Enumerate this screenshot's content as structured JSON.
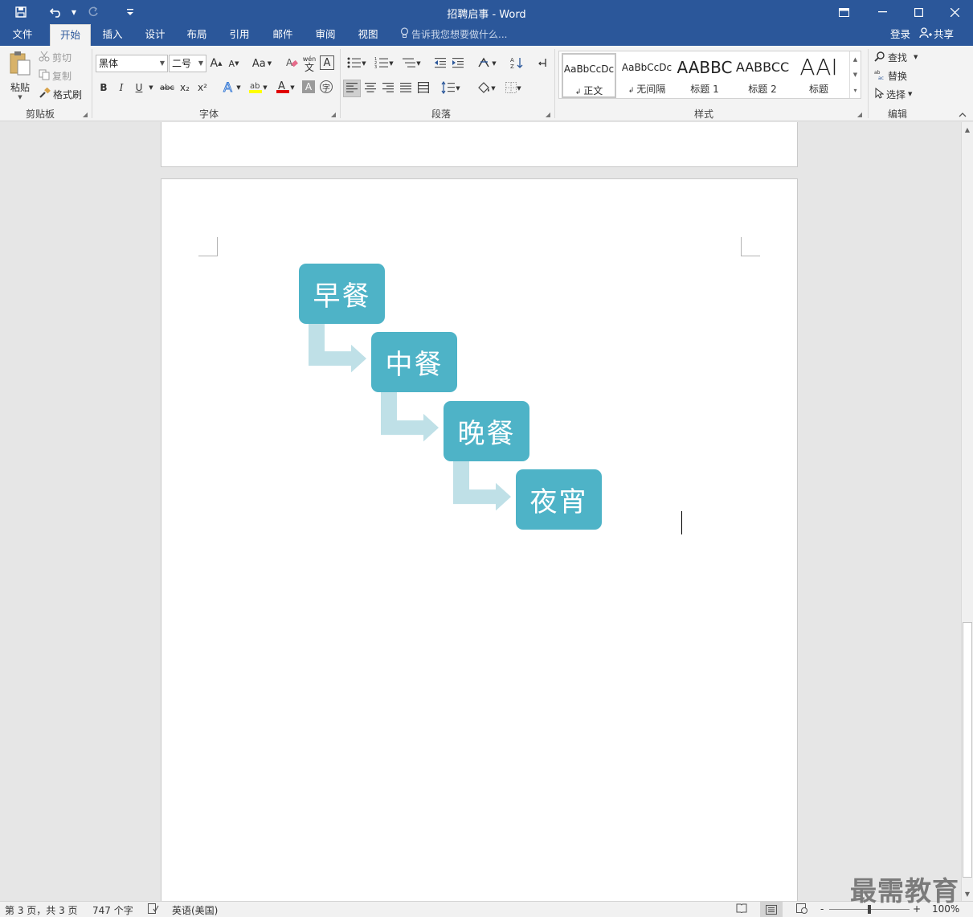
{
  "window": {
    "title": "招聘启事 - Word",
    "qa_save_icon": "save-icon",
    "qa_undo_icon": "undo-icon",
    "qa_redo_icon": "redo-icon",
    "qa_customize_icon": "customize-quick-access-icon"
  },
  "tabs": [
    "文件",
    "开始",
    "插入",
    "设计",
    "布局",
    "引用",
    "邮件",
    "审阅",
    "视图"
  ],
  "active_tab": "开始",
  "tell_me_placeholder": "告诉我您想要做什么...",
  "account": {
    "login": "登录",
    "share": "共享"
  },
  "ribbon": {
    "clipboard": {
      "label": "剪贴板",
      "paste": "粘贴",
      "cut": "剪切",
      "copy": "复制",
      "format_painter": "格式刷"
    },
    "font": {
      "label": "字体",
      "font_name": "黑体",
      "font_size": "二号",
      "bold": "B",
      "italic": "I",
      "underline": "U",
      "strike": "abc",
      "subscript": "x₂",
      "superscript": "x²",
      "grow": "A",
      "shrink": "A",
      "case": "Aa",
      "phonetic_top": "wén",
      "phonetic_bottom": "文",
      "font_color_letter": "A",
      "highlight_color": "#ffff00",
      "font_color": "#e00000"
    },
    "paragraph": {
      "label": "段落"
    },
    "styles": {
      "label": "样式",
      "items": [
        {
          "preview": "AaBbCcDc",
          "name": "正文"
        },
        {
          "preview": "AaBbCcDc",
          "name": "无间隔"
        },
        {
          "preview": "AABBC",
          "name": "标题 1"
        },
        {
          "preview": "AABBCC",
          "name": "标题 2"
        },
        {
          "preview": "AAI",
          "name": "标题"
        }
      ]
    },
    "editing": {
      "label": "编辑",
      "find": "查找",
      "replace": "替换",
      "select": "选择"
    }
  },
  "smartart": {
    "steps": [
      "早餐",
      "中餐",
      "晚餐",
      "夜宵"
    ],
    "box_color": "#4eb3c7",
    "arrow_color": "#bfe0e7"
  },
  "status": {
    "page": "第 3 页，共 3 页",
    "words": "747 个字",
    "language": "英语(美国)",
    "zoom": "100%",
    "zoom_minus": "-",
    "zoom_plus": "+"
  },
  "watermark": "最需教育"
}
